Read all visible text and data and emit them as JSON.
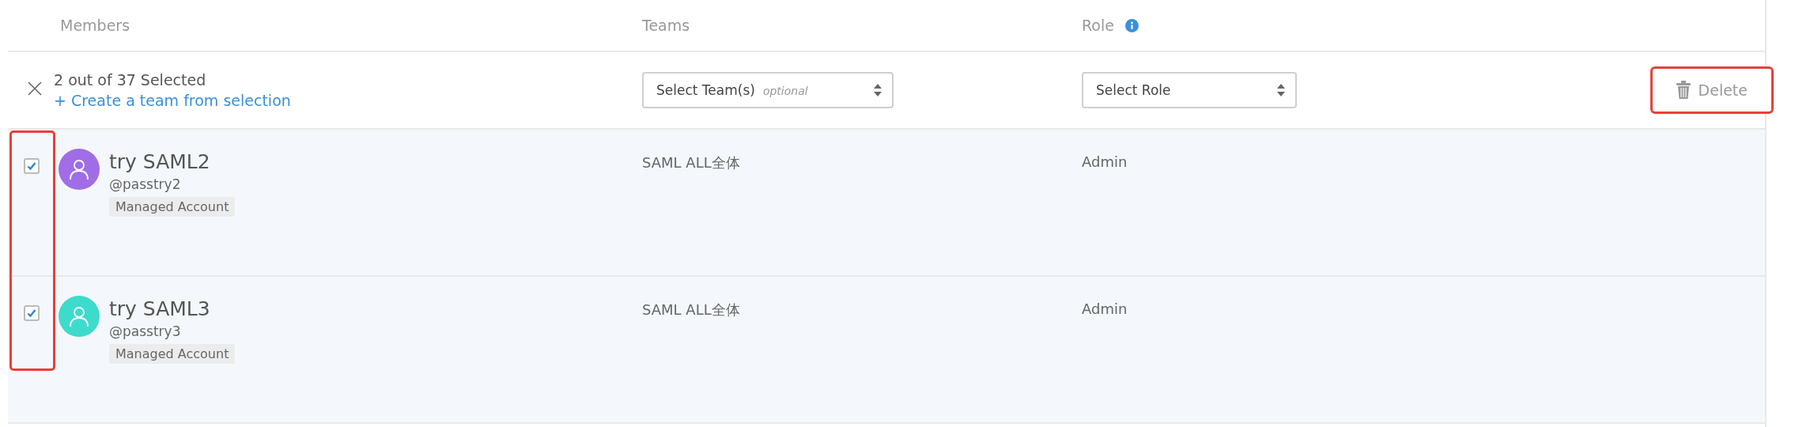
{
  "columns": [
    {
      "label": "Members"
    },
    {
      "label": "Teams"
    },
    {
      "label": "Role",
      "info": true
    }
  ],
  "selection_bar": {
    "count_text": "2 out of 37 Selected",
    "create_link": "+ Create a team from selection",
    "team_select": {
      "value": "Select Team(s)",
      "hint": "optional"
    },
    "role_select": {
      "value": "Select Role"
    },
    "delete_button": {
      "label": "Delete",
      "highlighted": true
    }
  },
  "checkbox_column_highlighted": true,
  "members": [
    {
      "name": "try SAML2",
      "username": "@passtry2",
      "badge": "Managed Account",
      "team": "SAML ALL全体",
      "role": "Admin",
      "checked": true,
      "color": "#a06de6"
    },
    {
      "name": "try SAML3",
      "username": "@passtry3",
      "badge": "Managed Account",
      "team": "SAML ALL全体",
      "role": "Admin",
      "checked": true,
      "color": "#3ddbcc"
    }
  ]
}
